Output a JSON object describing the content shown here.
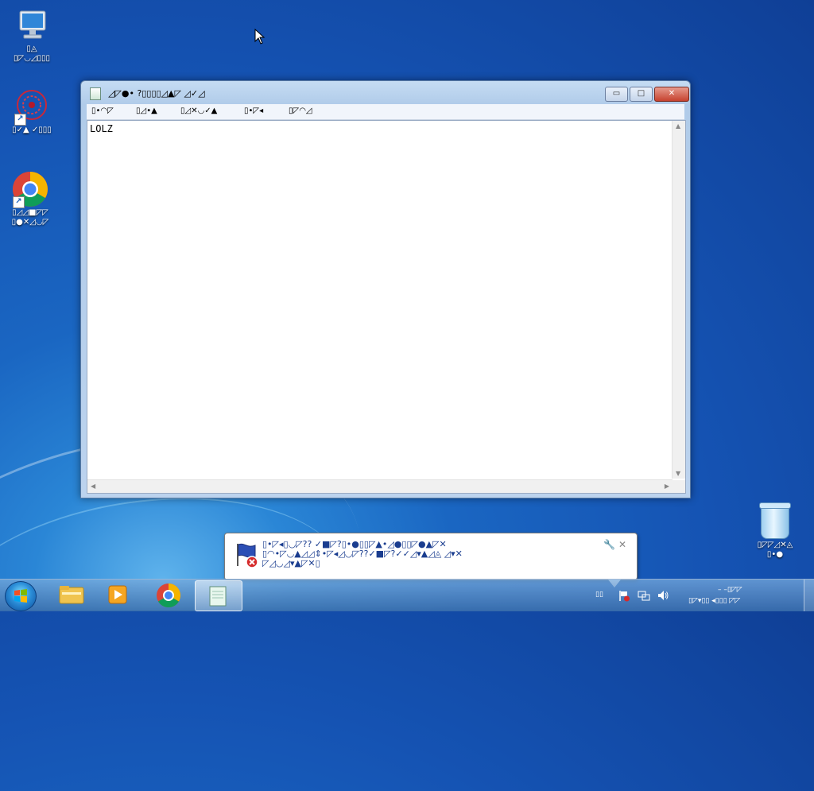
{
  "desktop": {
    "icons": [
      {
        "name": "computer-icon",
        "label": "▯◬\n▯◸◡◿▯▯▯"
      },
      {
        "name": "app-icon",
        "label": "▯✓▲ ✓▯▯▯"
      },
      {
        "name": "chrome-icon",
        "label": "▯◿◿■◸◸\n▯●✕◿◡◸"
      },
      {
        "name": "recycle-bin-icon",
        "label": "▯◸◸◿✕◬\n▯•●"
      }
    ]
  },
  "window": {
    "title": "◿◸●• ?▯▯▯▯◿▲◸ ◿✓◿",
    "controls": {
      "minimize": "▭",
      "maximize": "□",
      "close": "✕"
    },
    "menu": [
      "▯•◠◸",
      "▯◿•▲",
      "▯◿✕◡✓▲",
      "▯•◸◂",
      "▯◸◠◿"
    ],
    "content": "LOLZ"
  },
  "balloon": {
    "text": "▯•◸◂▯◡◸?? ✓■◸?▯•●▯▯◸▲•◿●▯▯◸●▲◸✕\n▯◠•◸◡▲◿◿⇕•◸◂◿◡◸??✓■◸?✓✓◿▾▲◿◬ ◿▾✕\n◸◿◡◿▾▲◸✕▯",
    "close": "✕"
  },
  "taskbar": {
    "tray_lang": "▯▯",
    "clock_time": "– –▯◸◸",
    "clock_date": "▯◸▾▯▯ ◂▯▯▯ ◸◸"
  }
}
